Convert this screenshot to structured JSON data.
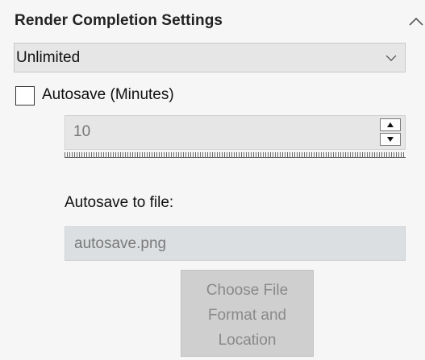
{
  "section": {
    "title": "Render Completion Settings",
    "collapse_icon": "chevron-up-icon"
  },
  "completion_dropdown": {
    "selected": "Unlimited",
    "chevron_icon": "chevron-down-icon"
  },
  "autosave": {
    "checkbox_label": "Autosave (Minutes)",
    "checked": false,
    "interval_value": "10",
    "spin_up_icon": "triangle-up-icon",
    "spin_down_icon": "triangle-down-icon"
  },
  "file": {
    "label": "Autosave to file:",
    "value": "autosave.png"
  },
  "choose_button": {
    "line1": "Choose File",
    "line2": "Format and",
    "line3": "Location",
    "enabled": false
  },
  "colors": {
    "panel_bg": "#f6f6f6",
    "field_bg": "#e6e6e6",
    "disabled_input_bg": "#dcdfe2",
    "disabled_button_bg": "#cfcfcf",
    "disabled_text": "#8a8a8a"
  }
}
